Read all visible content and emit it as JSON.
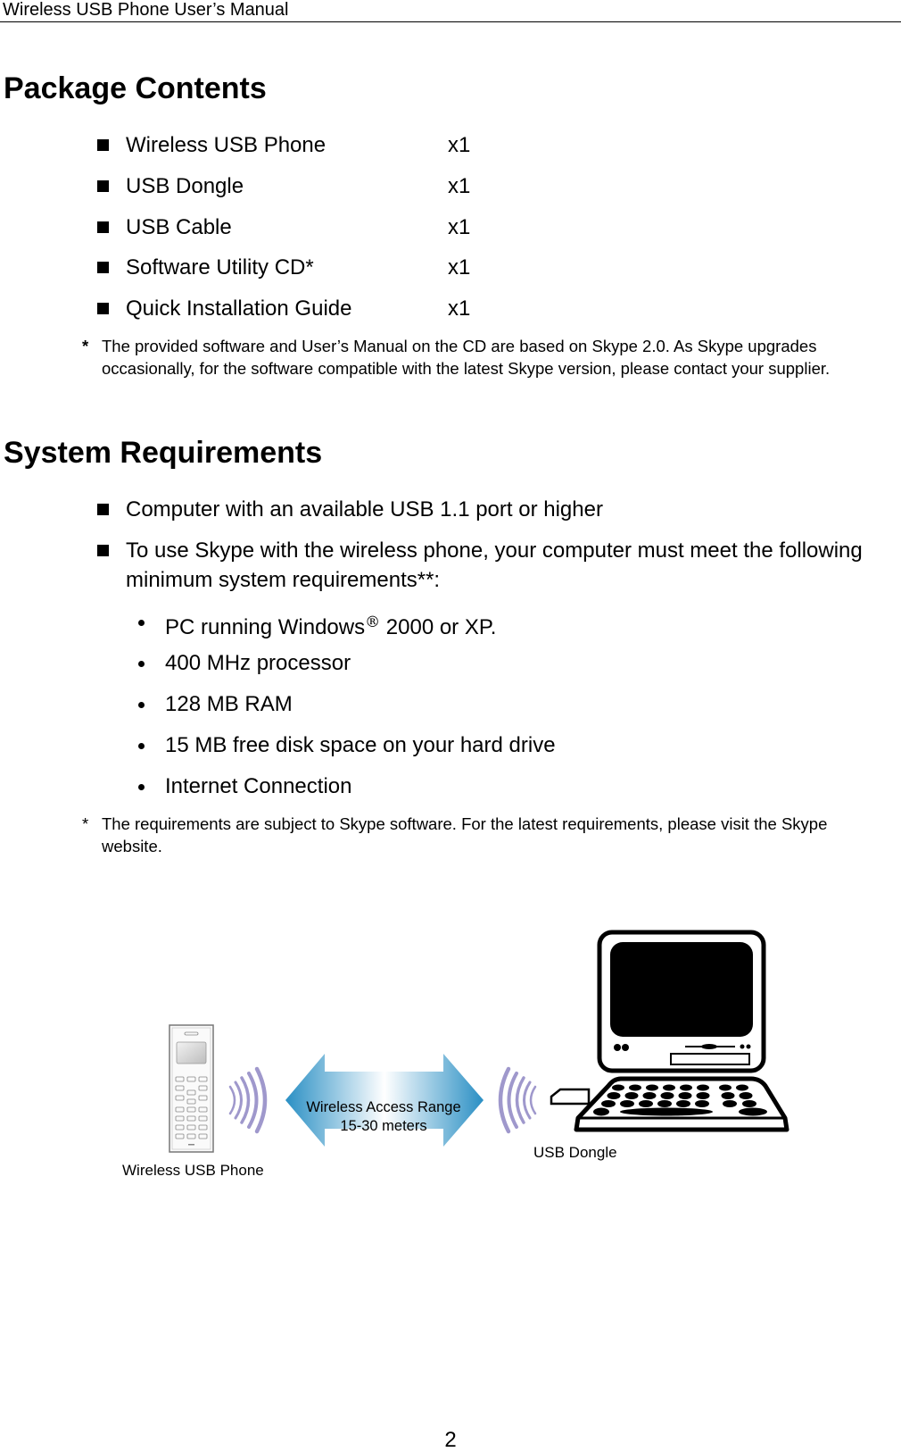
{
  "header": {
    "running_title": "Wireless USB Phone User’s Manual"
  },
  "package_contents": {
    "heading": "Package Contents",
    "items": [
      {
        "name": "Wireless USB Phone",
        "qty": "x1"
      },
      {
        "name": "USB Dongle",
        "qty": "x1"
      },
      {
        "name": "USB Cable",
        "qty": "x1"
      },
      {
        "name": "Software Utility CD*",
        "qty": "x1"
      },
      {
        "name": "Quick Installation Guide",
        "qty": "x1"
      }
    ],
    "footnote_marker": "*",
    "footnote": "The provided software and User’s Manual on the CD are based on Skype 2.0. As Skype upgrades occasionally, for the software compatible with the latest Skype version, please contact your supplier."
  },
  "system_requirements": {
    "heading": "System Requirements",
    "items": [
      "Computer with an available USB 1.1 port or higher",
      "To use Skype with the wireless phone, your computer must meet the following minimum system requirements**:"
    ],
    "sub_items": [
      {
        "before": "PC running Windows",
        "reg": "®",
        "after": " 2000 or XP."
      },
      {
        "text": "400 MHz processor"
      },
      {
        "text": "128 MB RAM"
      },
      {
        "text": "15 MB free disk space on your hard drive"
      },
      {
        "text": "Internet Connection"
      }
    ],
    "footnote_marker": "*",
    "footnote": "The requirements are subject to Skype software. For the latest requirements, please visit the Skype website."
  },
  "diagram": {
    "phone_label": "Wireless USB Phone",
    "dongle_label": "USB Dongle",
    "range_line1": "Wireless Access Range",
    "range_line2": "15-30 meters",
    "colors": {
      "wave": "#9f98cc",
      "arrow_edge": "#2a8fc4",
      "arrow_center": "#ffffff",
      "computer": "#000000"
    }
  },
  "footer": {
    "page_number": "2"
  }
}
